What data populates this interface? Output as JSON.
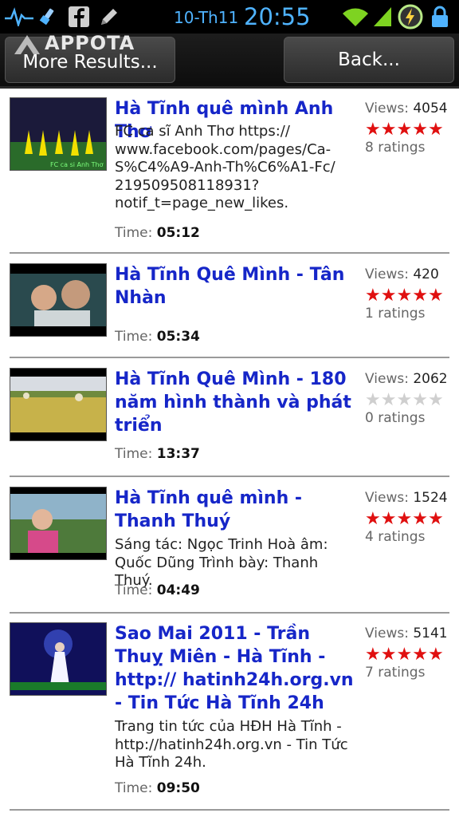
{
  "status_bar": {
    "date": "10-Th11",
    "time": "20:55"
  },
  "header": {
    "logo_text": "APPOTA",
    "more_results_label": "More Results...",
    "back_label": "Back..."
  },
  "videos": [
    {
      "title": "Hà Tĩnh quê mình Anh Thơ",
      "description": "FC ca sĩ Anh Thơ https://\nwww.facebook.com/pages/Ca-\nS%C4%A9-Anh-Th%C6%A1-Fc/\n219509508118931?\nnotif_t=page_new_likes.",
      "time_label": "Time:",
      "time": "05:12",
      "views_label": "Views:",
      "views": "4054",
      "stars_filled": 5,
      "ratings": "8 ratings"
    },
    {
      "title": "Hà Tĩnh Quê Mình - Tân Nhàn",
      "description": "",
      "time_label": "Time:",
      "time": "05:34",
      "views_label": "Views:",
      "views": "420",
      "stars_filled": 5,
      "ratings": "1 ratings"
    },
    {
      "title": "Hà Tĩnh Quê Mình - 180 năm hình thành và phát triển",
      "description": "",
      "time_label": "Time:",
      "time": "13:37",
      "views_label": "Views:",
      "views": "2062",
      "stars_filled": 0,
      "ratings": "0 ratings"
    },
    {
      "title": "Hà Tĩnh quê mình - Thanh Thuý",
      "description": "Sáng tác: Ngọc Trinh Hoà âm: Quốc Dũng Trình bày: Thanh Thuý.",
      "time_label": "Time:",
      "time": "04:49",
      "views_label": "Views:",
      "views": "1524",
      "stars_filled": 5,
      "ratings": "4 ratings"
    },
    {
      "title": "Sao Mai 2011 - Trần Thuỵ Miên - Hà Tĩnh - http:// hatinh24h.org.vn - Tin Tức Hà Tĩnh 24h",
      "description": "Trang tin tức của HĐH Hà Tĩnh - http://hatinh24h.org.vn - Tin Tức Hà Tĩnh 24h.",
      "time_label": "Time:",
      "time": "09:50",
      "views_label": "Views:",
      "views": "5141",
      "stars_filled": 5,
      "ratings": "7 ratings"
    }
  ],
  "colors": {
    "title": "#1626c8",
    "star_on": "#e01010",
    "star_off": "#cfcfcf",
    "status_accent": "#4fb3ff"
  }
}
